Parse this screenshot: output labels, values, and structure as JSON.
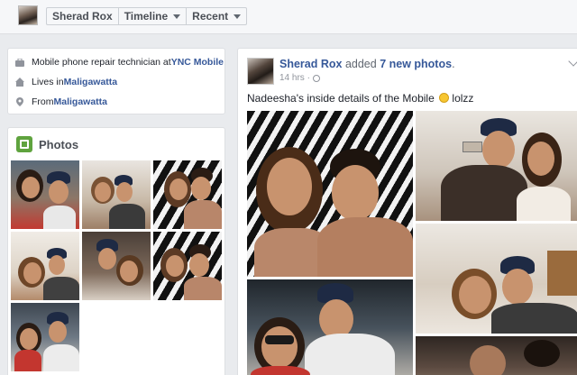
{
  "topbar": {
    "crumbs": [
      {
        "label": "Sherad Rox",
        "has_caret": false
      },
      {
        "label": "Timeline",
        "has_caret": true
      },
      {
        "label": "Recent",
        "has_caret": true
      }
    ]
  },
  "intro": {
    "work_prefix": "Mobile phone repair technician at ",
    "work_link": "YNC Mobile",
    "lives_prefix": "Lives in ",
    "lives_link": "Maligawatta",
    "from_prefix": "From ",
    "from_link": "Maligawatta"
  },
  "photos": {
    "title": "Photos"
  },
  "post": {
    "author": "Sherad Rox",
    "action": " added ",
    "action_link": "7 new photos",
    "action_suffix": ".",
    "time": "14 hrs · ",
    "text": "Nadeesha's inside details of the Mobile ",
    "text_suffix": " lolzz"
  },
  "colors": {
    "link": "#365899",
    "photos_icon": "#5fa33e",
    "background": "#e9ebee"
  }
}
